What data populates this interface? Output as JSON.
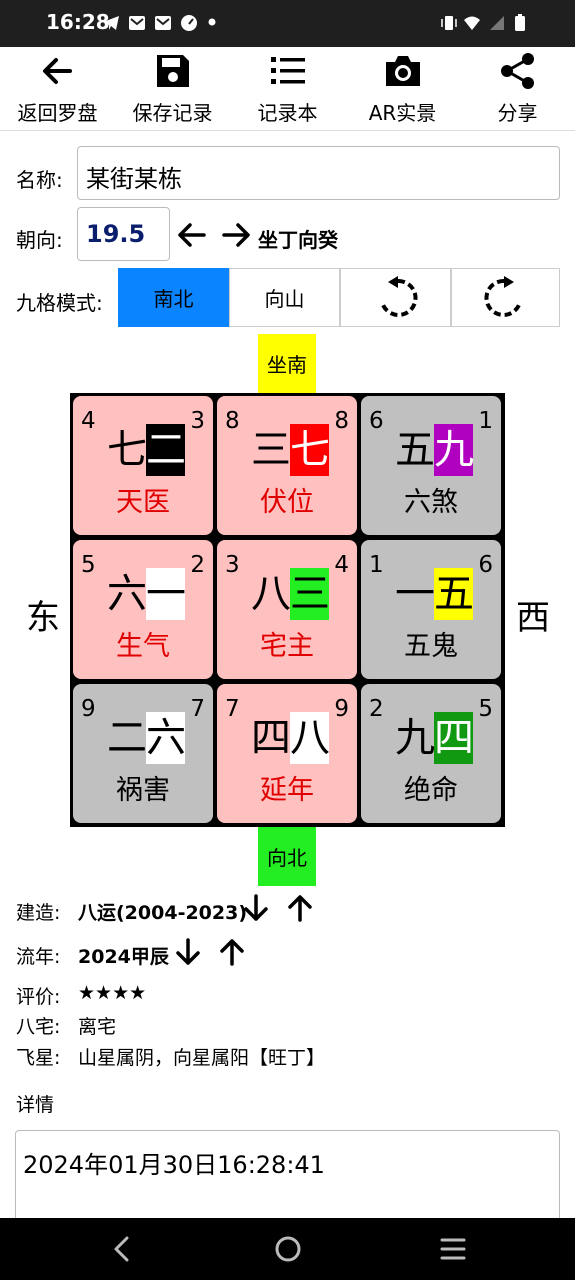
{
  "status": {
    "time": "16:28"
  },
  "toolbar": [
    {
      "label": "返回罗盘",
      "icon": "arrow-left-icon"
    },
    {
      "label": "保存记录",
      "icon": "save-icon"
    },
    {
      "label": "记录本",
      "icon": "list-icon"
    },
    {
      "label": "AR实景",
      "icon": "camera-icon"
    },
    {
      "label": "分享",
      "icon": "share-icon"
    }
  ],
  "form": {
    "name_label": "名称:",
    "name_value": "某街某栋",
    "direction_label": "朝向:",
    "direction_value": "19.5",
    "direction_text": "坐丁向癸",
    "mode_label": "九格模式:",
    "modes": [
      "南北",
      "向山"
    ],
    "active_mode": "南北"
  },
  "grid": {
    "top_label": "坐南",
    "bottom_label": "向北",
    "left_label": "东",
    "right_label": "西",
    "cells": [
      {
        "tl": "4",
        "tr": "3",
        "c1": "七",
        "c2": "二",
        "c2_bg": "#000000",
        "c2_fg": "#ffffff",
        "name": "天医",
        "name_color": "#e00000",
        "bg": "#ffc0c0"
      },
      {
        "tl": "8",
        "tr": "8",
        "c1": "三",
        "c2": "七",
        "c2_bg": "#ff0000",
        "c2_fg": "#ffffff",
        "name": "伏位",
        "name_color": "#e00000",
        "bg": "#ffc0c0"
      },
      {
        "tl": "6",
        "tr": "1",
        "c1": "五",
        "c2": "九",
        "c2_bg": "#b000c0",
        "c2_fg": "#ffffff",
        "name": "六煞",
        "name_color": "#000000",
        "bg": "#c0c0c0"
      },
      {
        "tl": "5",
        "tr": "2",
        "c1": "六",
        "c2": "一",
        "c2_bg": "#ffffff",
        "c2_fg": "#000000",
        "name": "生气",
        "name_color": "#e00000",
        "bg": "#ffc0c0"
      },
      {
        "tl": "3",
        "tr": "4",
        "c1": "八",
        "c2": "三",
        "c2_bg": "#22ee22",
        "c2_fg": "#000000",
        "name": "宅主",
        "name_color": "#e00000",
        "bg": "#ffc0c0"
      },
      {
        "tl": "1",
        "tr": "6",
        "c1": "一",
        "c2": "五",
        "c2_bg": "#ffff00",
        "c2_fg": "#000000",
        "name": "五鬼",
        "name_color": "#000000",
        "bg": "#c0c0c0"
      },
      {
        "tl": "9",
        "tr": "7",
        "c1": "二",
        "c2": "六",
        "c2_bg": "#ffffff",
        "c2_fg": "#000000",
        "name": "祸害",
        "name_color": "#000000",
        "bg": "#c0c0c0"
      },
      {
        "tl": "7",
        "tr": "9",
        "c1": "四",
        "c2": "八",
        "c2_bg": "#ffffff",
        "c2_fg": "#000000",
        "name": "延年",
        "name_color": "#e00000",
        "bg": "#ffc0c0"
      },
      {
        "tl": "2",
        "tr": "5",
        "c1": "九",
        "c2": "四",
        "c2_bg": "#119911",
        "c2_fg": "#ffffff",
        "name": "绝命",
        "name_color": "#000000",
        "bg": "#c0c0c0"
      }
    ]
  },
  "info": {
    "build_label": "建造:",
    "build_value": "八运(2004-2023)",
    "year_label": "流年:",
    "year_value": "2024甲辰",
    "rating_label": "评价:",
    "rating_value": "★★★★",
    "house_label": "八宅:",
    "house_value": "离宅",
    "star_label": "飞星:",
    "star_value": "山星属阴，向星属阳【旺丁】",
    "detail_label": "详情",
    "detail_value": "2024年01月30日16:28:41"
  },
  "colors": {
    "accent": "#0a84ff",
    "top_label_bg": "#ffff00",
    "bottom_label_bg": "#22ee22"
  }
}
